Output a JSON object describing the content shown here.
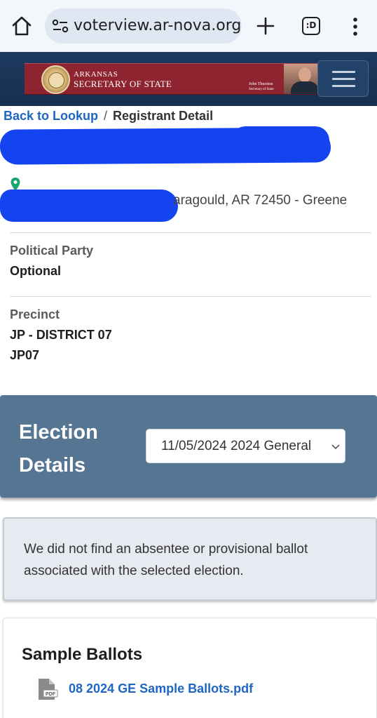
{
  "browser": {
    "url": "voterview.ar-nova.org/",
    "tab_count_label": ":D",
    "icons": [
      "home-icon",
      "site-settings-icon",
      "plus-icon",
      "tab-switcher-icon",
      "more-vert-icon"
    ]
  },
  "header": {
    "line1": "ARKANSAS",
    "line2": "SECRETARY OF STATE",
    "signature_name": "John Thurston",
    "signature_title": "Secretary of State",
    "colors": {
      "nav": "#1d3a5f",
      "banner": "#8e2430"
    }
  },
  "breadcrumb": {
    "back_label": "Back to Lookup",
    "separator": "/",
    "current": "Registrant Detail"
  },
  "registrant": {
    "address_visible": "aragould, AR 72450  -  Greene",
    "party_label": "Political Party",
    "party_value": "Optional",
    "precinct_label": "Precinct",
    "precinct_line1": "JP - DISTRICT 07",
    "precinct_line2": "JP07"
  },
  "election": {
    "title": "Election Details",
    "selected": "11/05/2024 2024 General",
    "color": "#567593"
  },
  "notice": {
    "text": "We did not find an absentee or provisional ballot associated with the selected election."
  },
  "sample_ballots": {
    "title": "Sample Ballots",
    "file_label": "08 2024 GE Sample Ballots.pdf",
    "file_icon_text": "PDF"
  },
  "link_color": "#1e66c4"
}
